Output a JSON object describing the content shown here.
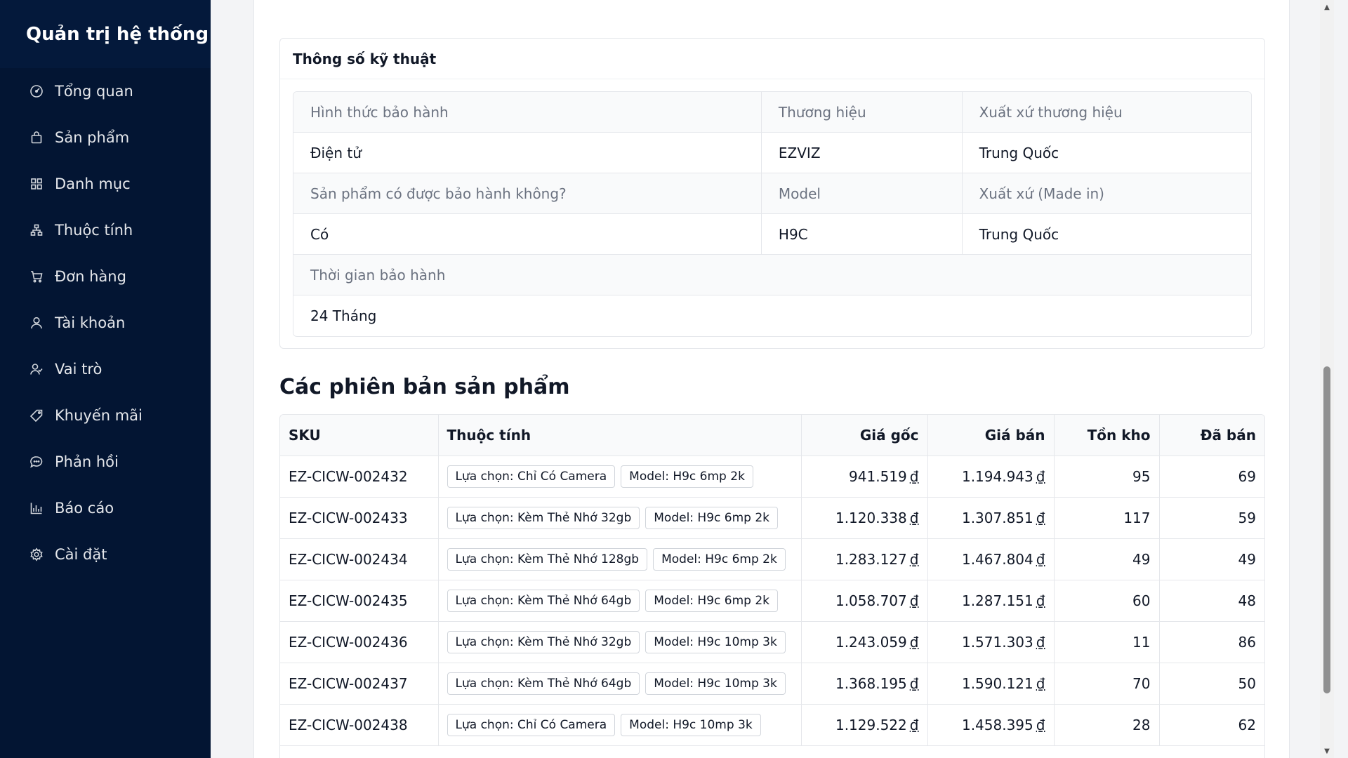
{
  "sidebar": {
    "title": "Quản trị hệ thống",
    "items": [
      {
        "label": "Tổng quan",
        "icon": "dashboard-icon"
      },
      {
        "label": "Sản phẩm",
        "icon": "shopping-bag-icon"
      },
      {
        "label": "Danh mục",
        "icon": "grid-icon"
      },
      {
        "label": "Thuộc tính",
        "icon": "sitemap-icon"
      },
      {
        "label": "Đơn hàng",
        "icon": "cart-icon"
      },
      {
        "label": "Tài khoản",
        "icon": "user-icon"
      },
      {
        "label": "Vai trò",
        "icon": "user-role-icon"
      },
      {
        "label": "Khuyến mãi",
        "icon": "tag-icon"
      },
      {
        "label": "Phản hồi",
        "icon": "chat-icon"
      },
      {
        "label": "Báo cáo",
        "icon": "bar-chart-icon"
      },
      {
        "label": "Cài đặt",
        "icon": "gear-icon"
      }
    ]
  },
  "specs": {
    "title": "Thông số kỹ thuật",
    "rows": [
      {
        "labels": [
          "Hình thức bảo hành",
          "Thương hiệu",
          "Xuất xứ thương hiệu"
        ],
        "values": [
          "Điện tử",
          "EZVIZ",
          "Trung Quốc"
        ]
      },
      {
        "labels": [
          "Sản phẩm có được bảo hành không?",
          "Model",
          "Xuất xứ (Made in)"
        ],
        "values": [
          "Có",
          "H9C",
          "Trung Quốc"
        ]
      },
      {
        "labels": [
          "Thời gian bảo hành"
        ],
        "values": [
          "24 Tháng"
        ]
      }
    ]
  },
  "variants": {
    "heading": "Các phiên bản sản phẩm",
    "columns": {
      "sku": "SKU",
      "attributes": "Thuộc tính",
      "original_price": "Giá gốc",
      "sale_price": "Giá bán",
      "stock": "Tồn kho",
      "sold": "Đã bán"
    },
    "currency": "₫",
    "rows": [
      {
        "sku": "EZ-CICW-002432",
        "tags": [
          "Lựa chọn: Chỉ Có Camera",
          "Model: H9c 6mp 2k"
        ],
        "original_price": "941.519",
        "sale_price": "1.194.943",
        "stock": "95",
        "sold": "69"
      },
      {
        "sku": "EZ-CICW-002433",
        "tags": [
          "Lựa chọn: Kèm Thẻ Nhớ 32gb",
          "Model: H9c 6mp 2k"
        ],
        "original_price": "1.120.338",
        "sale_price": "1.307.851",
        "stock": "117",
        "sold": "59"
      },
      {
        "sku": "EZ-CICW-002434",
        "tags": [
          "Lựa chọn: Kèm Thẻ Nhớ 128gb",
          "Model: H9c 6mp 2k"
        ],
        "original_price": "1.283.127",
        "sale_price": "1.467.804",
        "stock": "49",
        "sold": "49"
      },
      {
        "sku": "EZ-CICW-002435",
        "tags": [
          "Lựa chọn: Kèm Thẻ Nhớ 64gb",
          "Model: H9c 6mp 2k"
        ],
        "original_price": "1.058.707",
        "sale_price": "1.287.151",
        "stock": "60",
        "sold": "48"
      },
      {
        "sku": "EZ-CICW-002436",
        "tags": [
          "Lựa chọn: Kèm Thẻ Nhớ 32gb",
          "Model: H9c 10mp 3k"
        ],
        "original_price": "1.243.059",
        "sale_price": "1.571.303",
        "stock": "11",
        "sold": "86"
      },
      {
        "sku": "EZ-CICW-002437",
        "tags": [
          "Lựa chọn: Kèm Thẻ Nhớ 64gb",
          "Model: H9c 10mp 3k"
        ],
        "original_price": "1.368.195",
        "sale_price": "1.590.121",
        "stock": "70",
        "sold": "50"
      },
      {
        "sku": "EZ-CICW-002438",
        "tags": [
          "Lựa chọn: Chỉ Có Camera",
          "Model: H9c 10mp 3k"
        ],
        "original_price": "1.129.522",
        "sale_price": "1.458.395",
        "stock": "28",
        "sold": "62"
      }
    ]
  },
  "scrollbar": {
    "up_glyph": "▲",
    "down_glyph": "▼"
  },
  "colors": {
    "sidebar_bg": "#031533",
    "sidebar_header_bg": "#04193b"
  }
}
